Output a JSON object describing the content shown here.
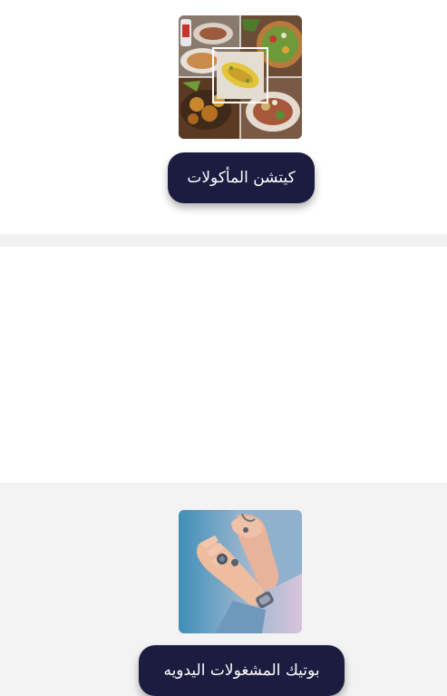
{
  "categories": [
    {
      "label": "كيتشن المأكولات",
      "image": "food-collage"
    },
    {
      "label": "بوتيك المشغولات اليدويه",
      "image": "handmade-jewelry-hands"
    }
  ],
  "colors": {
    "button_bg": "#1c1b40",
    "button_text": "#ffffff",
    "card_bg": "#ffffff",
    "divider": "#f1f1f2"
  }
}
